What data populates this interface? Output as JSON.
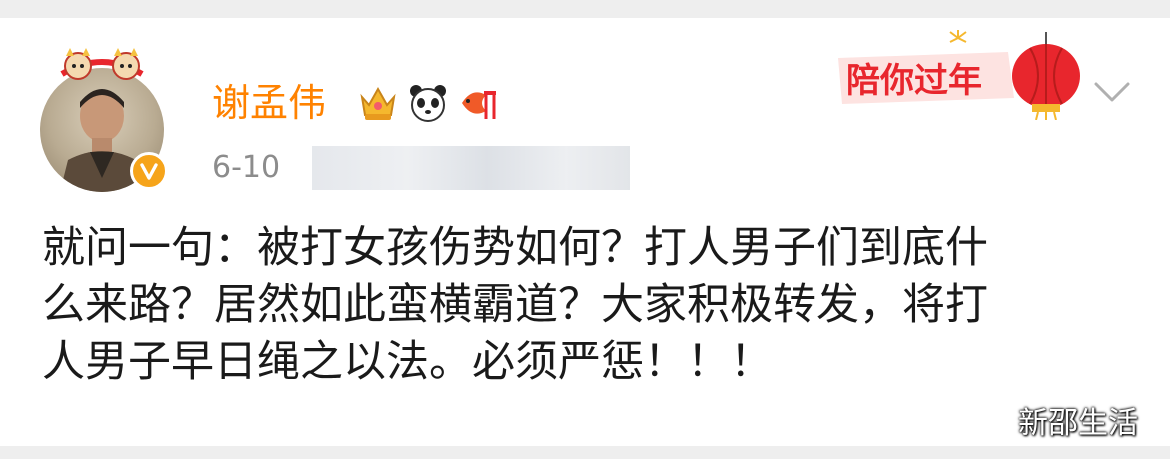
{
  "post": {
    "author": {
      "name": "谢孟伟",
      "badge_icons": [
        "crown-badge-icon",
        "panda-badge-icon",
        "koi-fish-badge-icon"
      ],
      "verified_icon": "verified-v-icon"
    },
    "date": "6-10",
    "campaign_banner": "陪你过年",
    "more_icon": "chevron-down-icon",
    "text_line_1": "就问一句：被打女孩伤势如何？打人男子们到底什",
    "text_line_2": "么来路？居然如此蛮横霸道？大家积极转发，将打",
    "text_line_3": "人男子早日绳之以法。必须严惩！！！"
  },
  "watermark": "新邵生活",
  "colors": {
    "username": "#ff8200",
    "verified": "#f6a41a",
    "date": "#8c8c8c",
    "banner_text": "#e8262d"
  }
}
